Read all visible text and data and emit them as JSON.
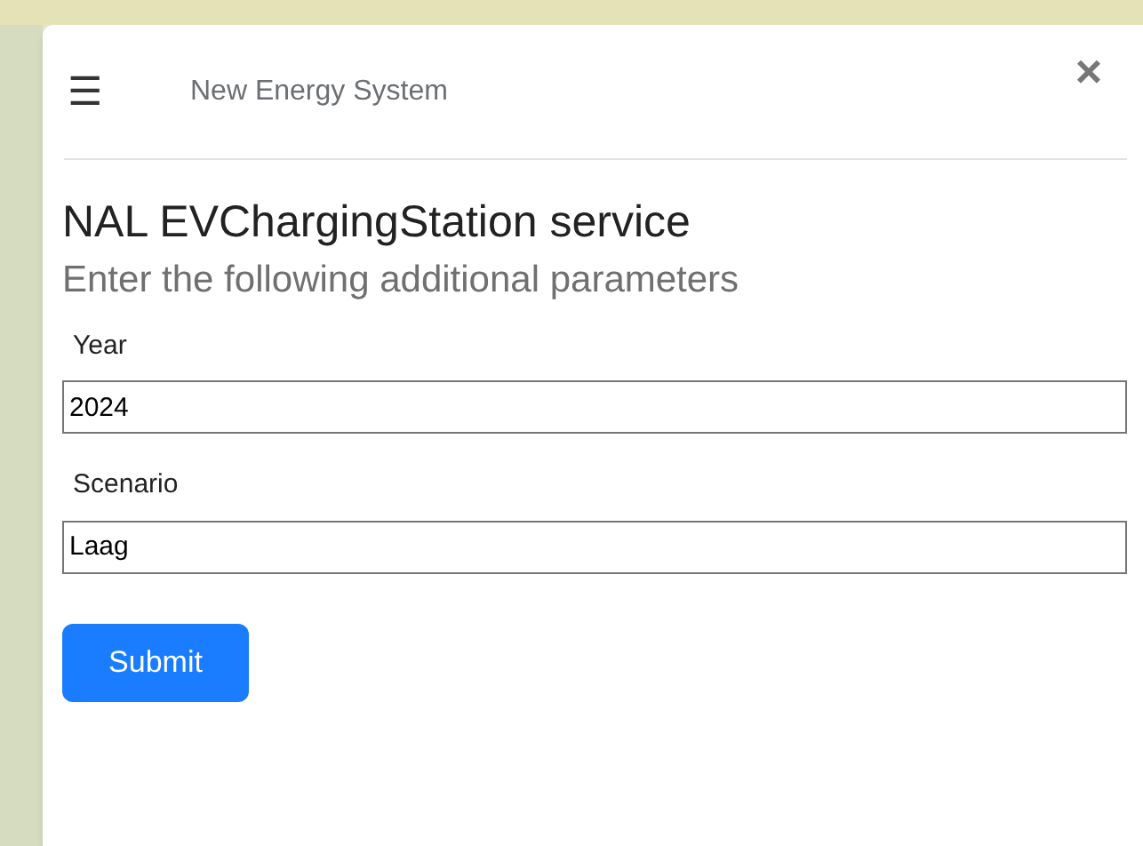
{
  "header": {
    "menu_icon": "☰",
    "title": "New Energy System",
    "close": "×"
  },
  "heading": "NAL EVChargingStation service",
  "subheading": "Enter the following additional parameters",
  "fields": [
    {
      "label": "Year",
      "value": "2024"
    },
    {
      "label": "Scenario",
      "value": "Laag"
    }
  ],
  "submit": "Submit"
}
